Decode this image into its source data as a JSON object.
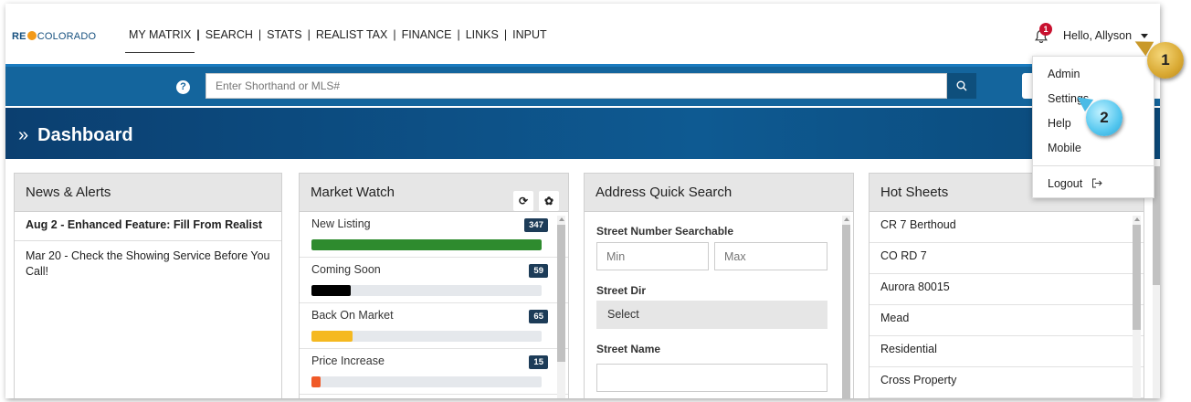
{
  "topnav": {
    "logo": {
      "re": "RE",
      "colorado": "COLORADO"
    },
    "links": [
      "MY MATRIX",
      "SEARCH",
      "STATS",
      "REALIST TAX",
      "FINANCE",
      "LINKS",
      "INPUT"
    ],
    "notification_count": "1",
    "greeting": "Hello, Allyson"
  },
  "search": {
    "placeholder": "Enter Shorthand or MLS#"
  },
  "dashboard": {
    "title": "Dashboard",
    "raquo": "»"
  },
  "news": {
    "title": "News & Alerts",
    "items": [
      "Aug 2 - Enhanced Feature: Fill From Realist",
      "Mar 20 - Check the Showing Service Before You Call!"
    ]
  },
  "market_watch": {
    "title": "Market Watch",
    "rows": [
      {
        "label": "New Listing",
        "count": "347",
        "fill": 1.0,
        "color": "#2e8b2e"
      },
      {
        "label": "Coming Soon",
        "count": "59",
        "fill": 0.17,
        "color": "#000000"
      },
      {
        "label": "Back On Market",
        "count": "65",
        "fill": 0.18,
        "color": "#f5b921"
      },
      {
        "label": "Price Increase",
        "count": "15",
        "fill": 0.04,
        "color": "#f05a28"
      }
    ]
  },
  "address_search": {
    "title": "Address Quick Search",
    "street_number_label": "Street Number Searchable",
    "min_placeholder": "Min",
    "max_placeholder": "Max",
    "street_dir_label": "Street Dir",
    "street_dir_value": "Select",
    "street_name_label": "Street Name"
  },
  "hot_sheets": {
    "title": "Hot Sheets",
    "items": [
      "CR 7 Berthoud",
      "CO RD 7",
      "Aurora 80015",
      "Mead",
      "Residential",
      "Cross Property"
    ]
  },
  "user_menu": {
    "items": [
      "Admin",
      "Settings",
      "Help",
      "Mobile"
    ],
    "logout": "Logout"
  },
  "callouts": [
    "1",
    "2"
  ]
}
